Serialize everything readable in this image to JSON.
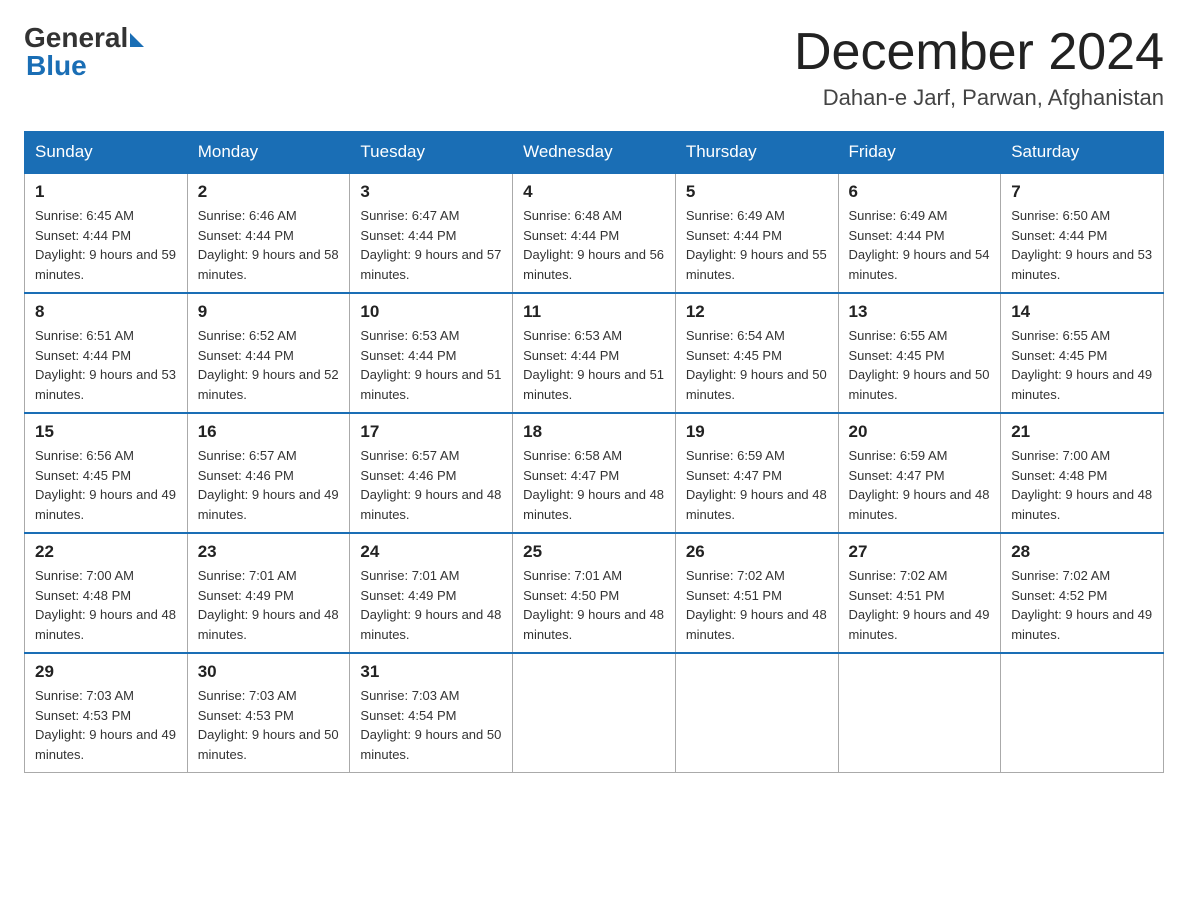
{
  "header": {
    "logo_general": "General",
    "logo_blue": "Blue",
    "month_title": "December 2024",
    "location": "Dahan-e Jarf, Parwan, Afghanistan"
  },
  "weekdays": [
    "Sunday",
    "Monday",
    "Tuesday",
    "Wednesday",
    "Thursday",
    "Friday",
    "Saturday"
  ],
  "weeks": [
    [
      {
        "day": "1",
        "sunrise": "6:45 AM",
        "sunset": "4:44 PM",
        "daylight": "9 hours and 59 minutes."
      },
      {
        "day": "2",
        "sunrise": "6:46 AM",
        "sunset": "4:44 PM",
        "daylight": "9 hours and 58 minutes."
      },
      {
        "day": "3",
        "sunrise": "6:47 AM",
        "sunset": "4:44 PM",
        "daylight": "9 hours and 57 minutes."
      },
      {
        "day": "4",
        "sunrise": "6:48 AM",
        "sunset": "4:44 PM",
        "daylight": "9 hours and 56 minutes."
      },
      {
        "day": "5",
        "sunrise": "6:49 AM",
        "sunset": "4:44 PM",
        "daylight": "9 hours and 55 minutes."
      },
      {
        "day": "6",
        "sunrise": "6:49 AM",
        "sunset": "4:44 PM",
        "daylight": "9 hours and 54 minutes."
      },
      {
        "day": "7",
        "sunrise": "6:50 AM",
        "sunset": "4:44 PM",
        "daylight": "9 hours and 53 minutes."
      }
    ],
    [
      {
        "day": "8",
        "sunrise": "6:51 AM",
        "sunset": "4:44 PM",
        "daylight": "9 hours and 53 minutes."
      },
      {
        "day": "9",
        "sunrise": "6:52 AM",
        "sunset": "4:44 PM",
        "daylight": "9 hours and 52 minutes."
      },
      {
        "day": "10",
        "sunrise": "6:53 AM",
        "sunset": "4:44 PM",
        "daylight": "9 hours and 51 minutes."
      },
      {
        "day": "11",
        "sunrise": "6:53 AM",
        "sunset": "4:44 PM",
        "daylight": "9 hours and 51 minutes."
      },
      {
        "day": "12",
        "sunrise": "6:54 AM",
        "sunset": "4:45 PM",
        "daylight": "9 hours and 50 minutes."
      },
      {
        "day": "13",
        "sunrise": "6:55 AM",
        "sunset": "4:45 PM",
        "daylight": "9 hours and 50 minutes."
      },
      {
        "day": "14",
        "sunrise": "6:55 AM",
        "sunset": "4:45 PM",
        "daylight": "9 hours and 49 minutes."
      }
    ],
    [
      {
        "day": "15",
        "sunrise": "6:56 AM",
        "sunset": "4:45 PM",
        "daylight": "9 hours and 49 minutes."
      },
      {
        "day": "16",
        "sunrise": "6:57 AM",
        "sunset": "4:46 PM",
        "daylight": "9 hours and 49 minutes."
      },
      {
        "day": "17",
        "sunrise": "6:57 AM",
        "sunset": "4:46 PM",
        "daylight": "9 hours and 48 minutes."
      },
      {
        "day": "18",
        "sunrise": "6:58 AM",
        "sunset": "4:47 PM",
        "daylight": "9 hours and 48 minutes."
      },
      {
        "day": "19",
        "sunrise": "6:59 AM",
        "sunset": "4:47 PM",
        "daylight": "9 hours and 48 minutes."
      },
      {
        "day": "20",
        "sunrise": "6:59 AM",
        "sunset": "4:47 PM",
        "daylight": "9 hours and 48 minutes."
      },
      {
        "day": "21",
        "sunrise": "7:00 AM",
        "sunset": "4:48 PM",
        "daylight": "9 hours and 48 minutes."
      }
    ],
    [
      {
        "day": "22",
        "sunrise": "7:00 AM",
        "sunset": "4:48 PM",
        "daylight": "9 hours and 48 minutes."
      },
      {
        "day": "23",
        "sunrise": "7:01 AM",
        "sunset": "4:49 PM",
        "daylight": "9 hours and 48 minutes."
      },
      {
        "day": "24",
        "sunrise": "7:01 AM",
        "sunset": "4:49 PM",
        "daylight": "9 hours and 48 minutes."
      },
      {
        "day": "25",
        "sunrise": "7:01 AM",
        "sunset": "4:50 PM",
        "daylight": "9 hours and 48 minutes."
      },
      {
        "day": "26",
        "sunrise": "7:02 AM",
        "sunset": "4:51 PM",
        "daylight": "9 hours and 48 minutes."
      },
      {
        "day": "27",
        "sunrise": "7:02 AM",
        "sunset": "4:51 PM",
        "daylight": "9 hours and 49 minutes."
      },
      {
        "day": "28",
        "sunrise": "7:02 AM",
        "sunset": "4:52 PM",
        "daylight": "9 hours and 49 minutes."
      }
    ],
    [
      {
        "day": "29",
        "sunrise": "7:03 AM",
        "sunset": "4:53 PM",
        "daylight": "9 hours and 49 minutes."
      },
      {
        "day": "30",
        "sunrise": "7:03 AM",
        "sunset": "4:53 PM",
        "daylight": "9 hours and 50 minutes."
      },
      {
        "day": "31",
        "sunrise": "7:03 AM",
        "sunset": "4:54 PM",
        "daylight": "9 hours and 50 minutes."
      },
      null,
      null,
      null,
      null
    ]
  ]
}
